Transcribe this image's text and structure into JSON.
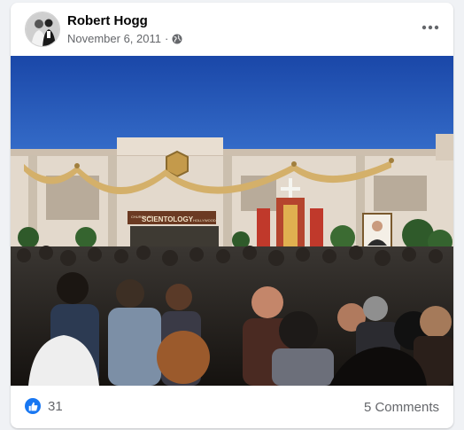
{
  "post": {
    "author": "Robert Hogg",
    "date": "November 6, 2011",
    "separator": "·",
    "privacy_icon": "globe-icon",
    "more_icon": "more-options-icon"
  },
  "photo": {
    "building_sign_small": "CHURCH OF",
    "building_sign": "SCIENTOLOGY",
    "building_sign_suffix": "HOLLYWOOD"
  },
  "footer": {
    "reaction_icon": "like-icon",
    "reaction_count": "31",
    "comments_label": "5 Comments"
  },
  "colors": {
    "accent": "#1877f2",
    "secondary_text": "#65676b",
    "primary_text": "#050505",
    "sky": "#1c4fb0"
  }
}
